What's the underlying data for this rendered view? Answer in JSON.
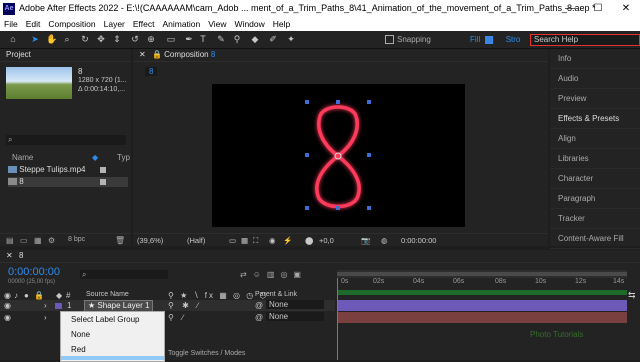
{
  "window": {
    "app_icon": "Ae",
    "title": "Adobe After Effects 2022 - E:\\!(CAAAAAAM\\cam_Adob ... ment_of_a_Trim_Paths_8\\41_Animation_of_the_movement_of_a_Trim_Paths_8.aep *",
    "minimize": "—",
    "maximize": "☐",
    "close": "✕"
  },
  "menu": [
    "File",
    "Edit",
    "Composition",
    "Layer",
    "Effect",
    "Animation",
    "View",
    "Window",
    "Help"
  ],
  "toolbar": {
    "snapping_label": "Snapping",
    "fill_label": "Fill",
    "stroke_label": "Stro",
    "search_placeholder": "Search Help"
  },
  "project": {
    "tab_label": "Project",
    "item_name": "8",
    "item_info_1": "1280 x 720 (1...",
    "item_info_2": "Δ 0:00:14:10,...",
    "search_icon": "search-icon",
    "col_name": "Name",
    "col_type": "Typ",
    "items": [
      {
        "name": "Steppe Tulips.mp4",
        "color": "#b4b4b4",
        "selected": false
      },
      {
        "name": "8",
        "color": "#b4b4b4",
        "selected": true
      }
    ],
    "bpc": "8 bpc"
  },
  "composition": {
    "tab_label": "Composition",
    "tab_name": "8",
    "breadcrumb": "8",
    "zoom": "(39,6%)",
    "resolution": "(Half)",
    "exposure": "+0,0",
    "timecode": "0:00:00:00",
    "glyph": "8",
    "glow_color": "#ff3b5c"
  },
  "right_panel": {
    "items": [
      "Info",
      "Audio",
      "Preview",
      "Effects & Presets",
      "Align",
      "Libraries",
      "Character",
      "Paragraph",
      "Tracker",
      "Content-Aware Fill"
    ]
  },
  "timeline": {
    "tab_label": "8",
    "timecode": "0:00:00:00",
    "frame_info": "00000 (25,00 fps)",
    "col_source": "Source Name",
    "col_parent": "Parent & Link",
    "layers": [
      {
        "num": "1",
        "name": "Shape Layer 1",
        "parent": "None",
        "bar_color": "#6c59b8"
      },
      {
        "num": "2",
        "name": "",
        "parent": "None",
        "bar_color": "#7a4040"
      }
    ],
    "ruler_labels": [
      "0s",
      "02s",
      "04s",
      "06s",
      "08s",
      "10s",
      "12s",
      "14s"
    ],
    "toggle_label": "Toggle Switches / Modes"
  },
  "context_menu": {
    "items": [
      "Select Label Group",
      "None",
      "Red",
      "Yellow"
    ],
    "selected_index": 3
  },
  "watermark": "Photo Tutorials"
}
